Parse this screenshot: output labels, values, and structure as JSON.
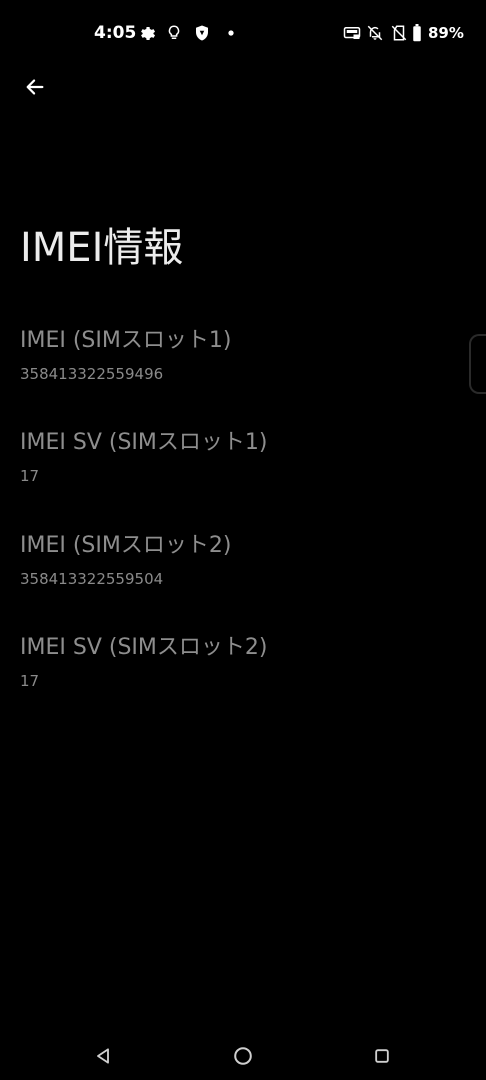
{
  "status_bar": {
    "time": "4:05",
    "battery_percent": "89%",
    "left_icons": [
      "gear-icon",
      "lightbulb-icon",
      "shield-icon",
      "dot-icon"
    ],
    "right_icons": [
      "auto-brightness-icon",
      "notifications-off-icon",
      "no-sim-icon",
      "battery-icon"
    ]
  },
  "header": {
    "back_icon": "arrow-left-icon"
  },
  "page": {
    "title": "IMEI情報"
  },
  "items": [
    {
      "label": "IMEI (SIMスロット1)",
      "value": "358413322559496"
    },
    {
      "label": "IMEI SV (SIMスロット1)",
      "value": "17"
    },
    {
      "label": "IMEI (SIMスロット2)",
      "value": "358413322559504"
    },
    {
      "label": "IMEI SV (SIMスロット2)",
      "value": "17"
    }
  ],
  "nav_bar": {
    "icons": [
      "back-triangle-icon",
      "home-circle-icon",
      "recents-square-icon"
    ]
  }
}
